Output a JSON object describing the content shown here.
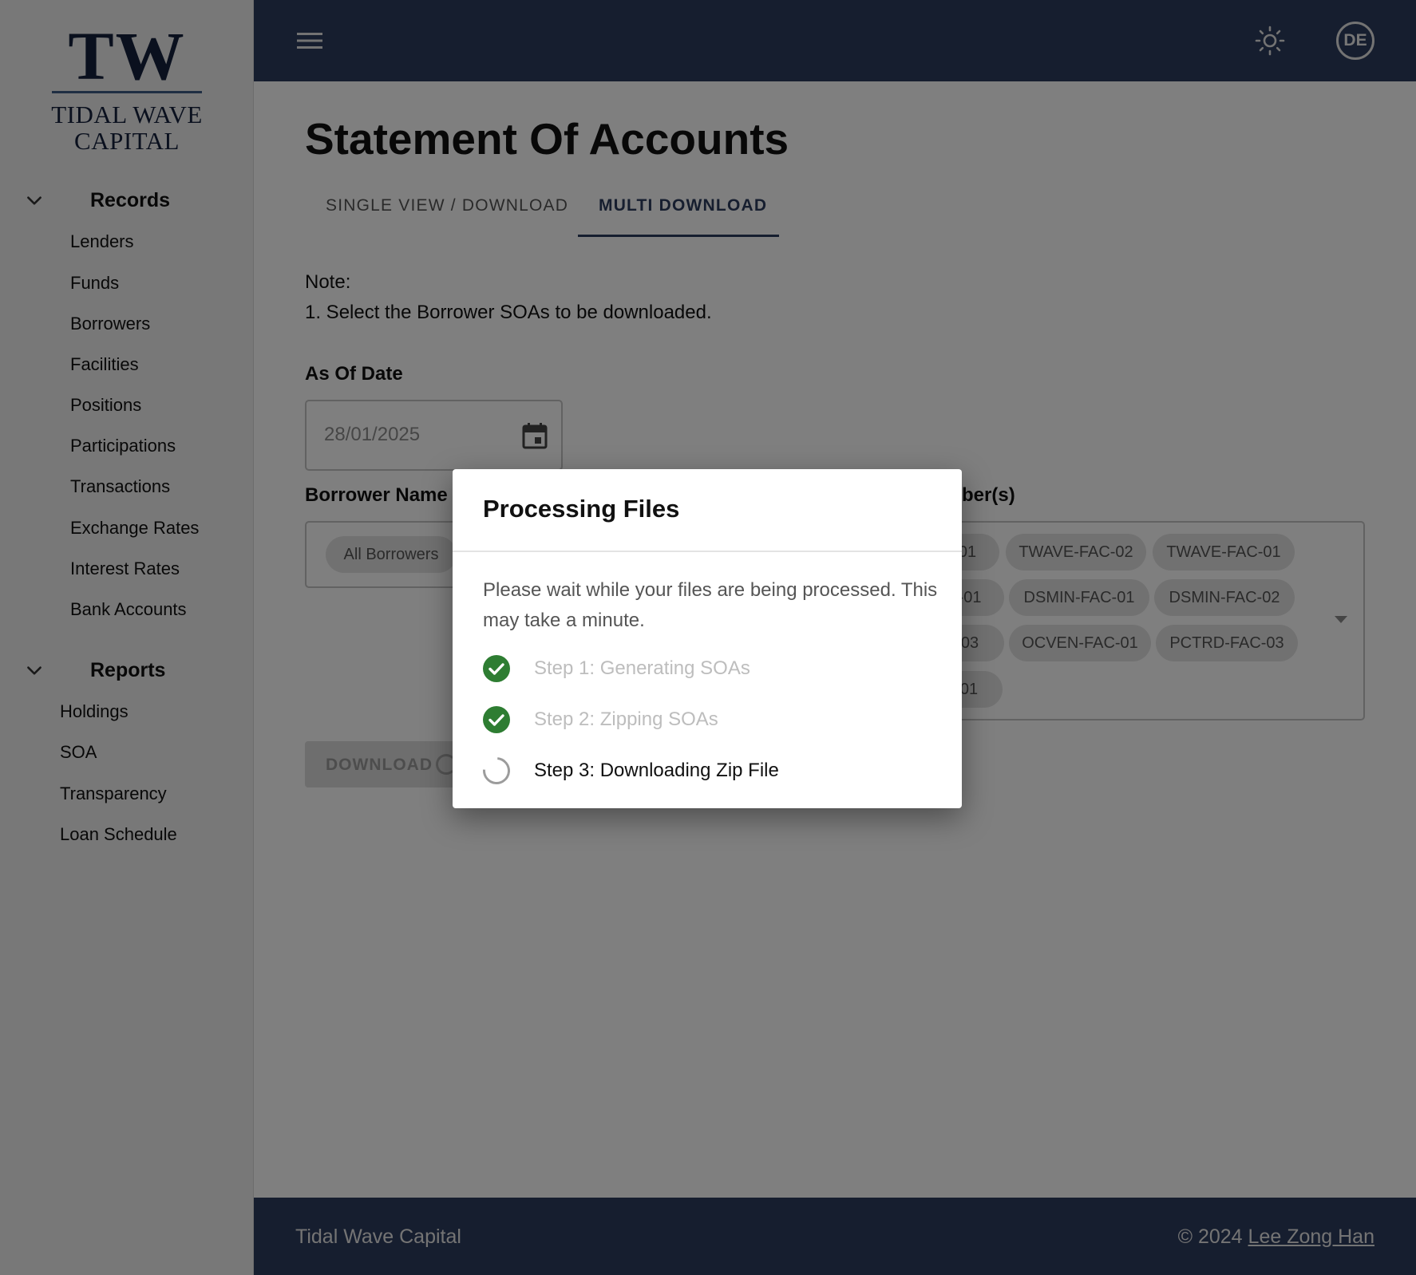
{
  "brand": {
    "logo_mark": "TW",
    "logo_line1": "TIDAL WAVE",
    "logo_line2": "CAPITAL"
  },
  "sidebar": {
    "records": {
      "title": "Records",
      "items": [
        "Lenders",
        "Funds",
        "Borrowers",
        "Facilities",
        "Positions",
        "Participations",
        "Transactions",
        "Exchange Rates",
        "Interest Rates",
        "Bank Accounts"
      ]
    },
    "reports": {
      "title": "Reports",
      "items": [
        "Holdings",
        "SOA",
        "Transparency",
        "Loan Schedule"
      ]
    }
  },
  "topbar": {
    "menu_icon": "hamburger-menu-icon",
    "theme_icon": "sun-icon",
    "avatar_initials": "DE"
  },
  "main": {
    "title": "Statement Of Accounts",
    "tabs": [
      {
        "label": "SINGLE VIEW / DOWNLOAD",
        "active": false
      },
      {
        "label": "MULTI DOWNLOAD",
        "active": true
      }
    ],
    "note_heading": "Note:",
    "note_line1": "1. Select the Borrower SOAs to be downloaded.",
    "as_of_date_label": "As Of Date",
    "as_of_date_value": "28/01/2025",
    "borrower_label": "Borrower Name",
    "borrower_chip": "All Borrowers",
    "facility_label_visible": "ber(s)",
    "facility_chips": [
      [
        "01",
        "TWAVE-FAC-02",
        "TWAVE-FAC-01"
      ],
      [
        "-01",
        "DSMIN-FAC-01",
        "DSMIN-FAC-02"
      ],
      [
        "03",
        "OCVEN-FAC-01",
        "PCTRD-FAC-03"
      ],
      [
        "01"
      ]
    ],
    "download_label": "DOWNLOAD"
  },
  "dialog": {
    "title": "Processing Files",
    "message": "Please wait while your files are being processed. This may take a minute.",
    "steps": [
      {
        "label": "Step 1: Generating SOAs",
        "status": "done"
      },
      {
        "label": "Step 2: Zipping SOAs",
        "status": "done"
      },
      {
        "label": "Step 3: Downloading Zip File",
        "status": "in-progress"
      }
    ],
    "done_color": "#2e7d32"
  },
  "footer": {
    "company": "Tidal Wave Capital",
    "copyright": "© 2024",
    "author": "Lee Zong Han"
  },
  "colors": {
    "nav_bg": "#2d3c5e",
    "accent": "#2d3c5e"
  }
}
